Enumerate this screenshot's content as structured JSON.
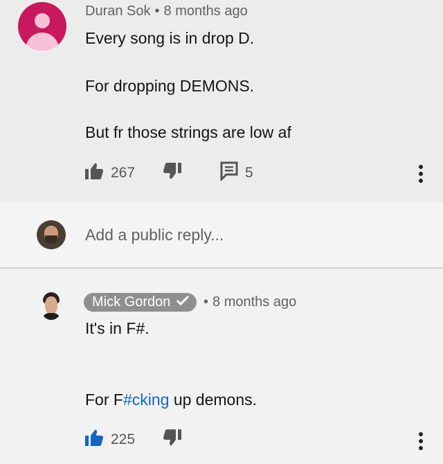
{
  "comment": {
    "author": "Duran Sok",
    "separator": "•",
    "time": "8 months ago",
    "lines": [
      "Every song is in drop D.",
      "For dropping DEMONS.",
      "But fr those strings are low af"
    ],
    "likes": "267",
    "replies": "5"
  },
  "reply_box": {
    "placeholder": "Add a public reply..."
  },
  "reply": {
    "author": "Mick Gordon",
    "separator": "•",
    "time": "8 months ago",
    "line1": "It's in F#.",
    "line2_prefix": "For F",
    "line2_link": "#cking",
    "line2_suffix": " up demons.",
    "likes": "225"
  },
  "colors": {
    "avatar_pink": "#c8185e",
    "link_blue": "#1565c0",
    "liked_blue": "#1565c0"
  },
  "icons": [
    "thumbs-up-icon",
    "thumbs-down-icon",
    "comment-icon",
    "more-vert-icon",
    "verified-check-icon"
  ]
}
